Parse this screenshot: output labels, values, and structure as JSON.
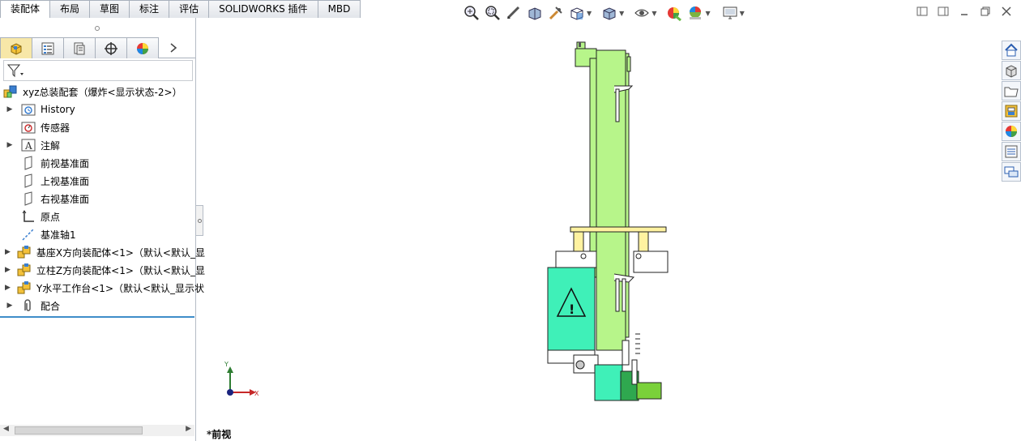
{
  "tabs": [
    {
      "label": "装配体",
      "active": true
    },
    {
      "label": "布局",
      "active": false
    },
    {
      "label": "草图",
      "active": false
    },
    {
      "label": "标注",
      "active": false
    },
    {
      "label": "评估",
      "active": false
    },
    {
      "label": "SOLIDWORKS 插件",
      "active": false
    },
    {
      "label": "MBD",
      "active": false
    }
  ],
  "pane_tabs": [
    {
      "icon": "feature-manager-icon",
      "active": true
    },
    {
      "icon": "property-manager-icon",
      "active": false
    },
    {
      "icon": "configuration-manager-icon",
      "active": false
    },
    {
      "icon": "dimxpert-manager-icon",
      "active": false
    },
    {
      "icon": "display-manager-icon",
      "active": false
    }
  ],
  "tree": {
    "root": "xyz总装配套（爆炸<显示状态-2>）",
    "items": [
      {
        "label": "History",
        "icon": "history-folder-icon",
        "expandable": true
      },
      {
        "label": "传感器",
        "icon": "sensors-icon",
        "expandable": false
      },
      {
        "label": "注解",
        "icon": "annotations-icon",
        "expandable": true
      },
      {
        "label": "前视基准面",
        "icon": "plane-icon",
        "expandable": false
      },
      {
        "label": "上视基准面",
        "icon": "plane-icon",
        "expandable": false
      },
      {
        "label": "右视基准面",
        "icon": "plane-icon",
        "expandable": false
      },
      {
        "label": "原点",
        "icon": "origin-icon",
        "expandable": false
      },
      {
        "label": "基准轴1",
        "icon": "axis-icon",
        "expandable": false
      },
      {
        "label": "基座X方向装配体<1>（默认<默认_显",
        "icon": "subassembly-icon",
        "expandable": true
      },
      {
        "label": "立柱Z方向装配体<1>（默认<默认_显",
        "icon": "subassembly-icon",
        "expandable": true
      },
      {
        "label": "Y水平工作台<1>（默认<默认_显示状",
        "icon": "subassembly-icon",
        "expandable": true
      },
      {
        "label": "配合",
        "icon": "mates-icon",
        "expandable": true
      }
    ]
  },
  "viewport": {
    "view_name": "*前视",
    "triad": {
      "x_label": "X",
      "y_label": "Y"
    }
  },
  "colors": {
    "accent": "#3f8dc9",
    "model_green": "#b7f58a",
    "model_teal": "#3ff0b8",
    "model_yellow": "#fff2a0"
  }
}
